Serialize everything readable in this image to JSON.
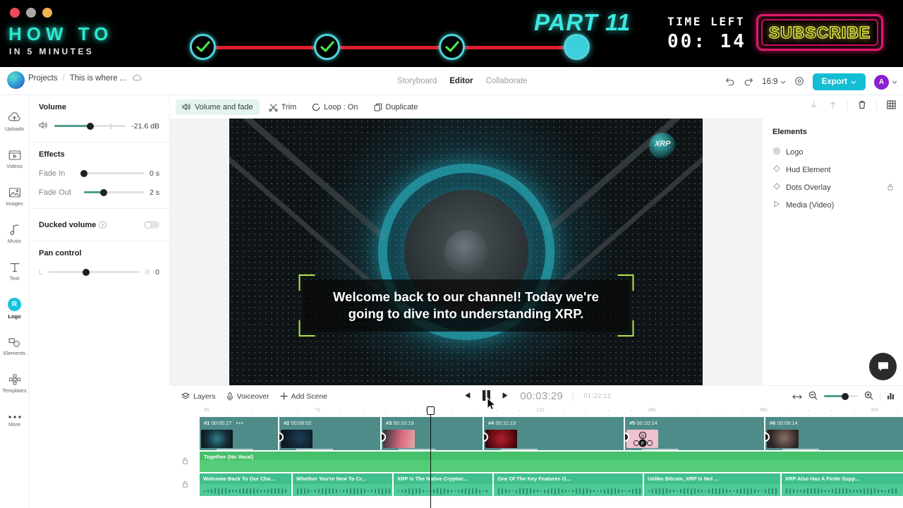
{
  "banner": {
    "title_main": "HOW TO",
    "title_sub": "IN 5 MINUTES",
    "part_label": "PART 11",
    "time_left_label": "TIME LEFT",
    "time_left_value": "00: 14",
    "subscribe_label": "SUBSCRIBE",
    "accent_cyan": "#2ee6cf",
    "accent_red": "#e11d2e",
    "accent_pink": "#e0186b",
    "accent_yellow": "#e9f04a",
    "progress_steps": 4,
    "progress_completed": 3
  },
  "header": {
    "breadcrumb_root": "Projects",
    "breadcrumb_sep": "/",
    "project_name": "This is where ...",
    "cloud_icon": "cloud-icon",
    "tabs": [
      {
        "label": "Storyboard",
        "active": false
      },
      {
        "label": "Editor",
        "active": true
      },
      {
        "label": "Collaborate",
        "active": false
      }
    ],
    "undo_icon": "undo-icon",
    "redo_icon": "redo-icon",
    "aspect_ratio": "16:9",
    "settings_icon": "gear-icon",
    "export_label": "Export",
    "avatar_initial": "A"
  },
  "rail": {
    "items": [
      {
        "label": "Uploads",
        "icon": "cloud-upload-icon",
        "active": false
      },
      {
        "label": "Videos",
        "icon": "video-icon",
        "active": false
      },
      {
        "label": "Images",
        "icon": "image-icon",
        "active": false
      },
      {
        "label": "Music",
        "icon": "music-note-icon",
        "active": false
      },
      {
        "label": "Text",
        "icon": "text-icon",
        "active": false
      },
      {
        "label": "Logo",
        "icon": "logo-badge-icon",
        "active": true
      },
      {
        "label": "Elements",
        "icon": "shapes-icon",
        "active": false
      },
      {
        "label": "Templates",
        "icon": "templates-icon",
        "active": false
      },
      {
        "label": "More",
        "icon": "ellipsis-icon",
        "active": false
      }
    ]
  },
  "properties": {
    "volume": {
      "title": "Volume",
      "speaker_icon": "speaker-icon",
      "value": "-21.6 dB",
      "fill_percent": 50
    },
    "effects": {
      "title": "Effects",
      "fade_in_label": "Fade In",
      "fade_in_value": "0 s",
      "fade_in_percent": 0,
      "fade_out_label": "Fade Out",
      "fade_out_value": "2 s",
      "fade_out_percent": 33
    },
    "ducked": {
      "label": "Ducked volume",
      "info_icon": "info-icon",
      "enabled": false
    },
    "pan": {
      "title": "Pan control",
      "left_mark": "L",
      "right_mark": "R",
      "value": "0",
      "percent": 50
    }
  },
  "editor_toolbar": {
    "buttons": [
      {
        "label": "Volume and fade",
        "icon": "speaker-icon",
        "active": true
      },
      {
        "label": "Trim",
        "icon": "scissors-icon",
        "active": false
      },
      {
        "label": "Loop : On",
        "icon": "loop-icon",
        "active": false
      },
      {
        "label": "Duplicate",
        "icon": "duplicate-icon",
        "active": false
      }
    ],
    "right_icons": [
      "send-backward-icon",
      "bring-forward-icon",
      "trash-icon",
      "grid-icon"
    ]
  },
  "preview": {
    "caption": "Welcome back to our channel! Today we're going to dive into understanding XRP.",
    "watermark_text": "XRP",
    "selection_color": "#b7e24c"
  },
  "elements_panel": {
    "title": "Elements",
    "items": [
      {
        "label": "Logo",
        "icon": "target-icon",
        "locked": false
      },
      {
        "label": "Hud Element",
        "icon": "diamond-icon",
        "locked": false
      },
      {
        "label": "Dots Overlay",
        "icon": "diamond-icon",
        "locked": true
      },
      {
        "label": "Media (Video)",
        "icon": "play-icon",
        "locked": false
      }
    ]
  },
  "timeline_bar": {
    "layers_label": "Layers",
    "layers_icon": "layers-icon",
    "voiceover_label": "Voiceover",
    "voiceover_icon": "microphone-icon",
    "add_scene_label": "Add Scene",
    "add_scene_icon": "plus-icon",
    "skip_back_icon": "skip-back-icon",
    "pause_icon": "pause-icon",
    "skip_forward_icon": "skip-forward-icon",
    "current_time": "00:03:29",
    "total_duration": "01:22:12",
    "fit_icon": "fit-width-icon",
    "zoom_out_icon": "zoom-out-icon",
    "zoom_in_icon": "zoom-in-icon",
    "zoom_percent": 62,
    "waveform_icon": "waveform-icon"
  },
  "timeline": {
    "ruler_labels": [
      "0s",
      "7s",
      "14s",
      "21s",
      "28s",
      "35s",
      "42s"
    ],
    "playhead_time": "00:03:29",
    "video_clips": [
      {
        "num": "#1",
        "duration": "00:05:27",
        "menu": "•••",
        "thumb": "t1"
      },
      {
        "num": "#2",
        "duration": "00:08:02",
        "menu": "",
        "thumb": "t2"
      },
      {
        "num": "#3",
        "duration": "00:10:19",
        "menu": "",
        "thumb": "t3"
      },
      {
        "num": "#4",
        "duration": "00:11:13",
        "menu": "",
        "thumb": "t4"
      },
      {
        "num": "#5",
        "duration": "00:10:14",
        "menu": "",
        "thumb": "t5"
      },
      {
        "num": "#6",
        "duration": "00:09:14",
        "menu": "",
        "thumb": "t6"
      }
    ],
    "audio_track": {
      "title": "Together (No Vocal)"
    },
    "subtitle_clips": [
      "Welcome Back To Our Cha...",
      "Whether You're New To Cr...",
      "XRP Is The Native Cryptoc...",
      "One Of The Key Features O...",
      "Unlike Bitcoin, XRP Is Not ...",
      "XRP Also Has A Finite Supp..."
    ],
    "lock_icon": "lock-icon"
  },
  "chat": {
    "icon": "chat-bubble-icon"
  }
}
